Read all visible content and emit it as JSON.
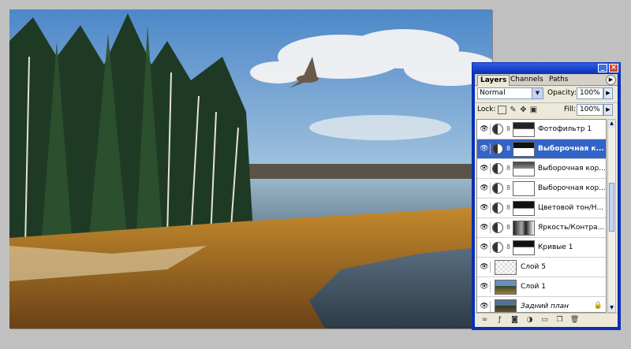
{
  "panel": {
    "tabs": [
      {
        "label": "Layers",
        "active": true
      },
      {
        "label": "Channels",
        "active": false
      },
      {
        "label": "Paths",
        "active": false
      }
    ],
    "blend_mode": "Normal",
    "opacity_label": "Opacity:",
    "opacity_value": "100%",
    "lock_label": "Lock:",
    "fill_label": "Fill:",
    "fill_value": "100%",
    "layers": [
      {
        "name": "Фотофильтр 1",
        "kind": "adjustment",
        "mask": "dark-top",
        "selected": false
      },
      {
        "name": "Выборочная к...",
        "kind": "adjustment",
        "mask": "dark-top",
        "selected": true
      },
      {
        "name": "Выборочная кор...",
        "kind": "adjustment",
        "mask": "grey-top",
        "selected": false
      },
      {
        "name": "Выборочная кор...",
        "kind": "adjustment",
        "mask": "white",
        "selected": false
      },
      {
        "name": "Цветовой тон/Н...",
        "kind": "adjustment",
        "mask": "dark-top",
        "selected": false
      },
      {
        "name": "Яркость/Контра...",
        "kind": "adjustment",
        "mask": "dark-mixed",
        "selected": false
      },
      {
        "name": "Кривые 1",
        "kind": "adjustment",
        "mask": "dark-top",
        "selected": false
      },
      {
        "name": "Слой 5",
        "kind": "transparent",
        "selected": false
      },
      {
        "name": "Слой 1",
        "kind": "photo",
        "selected": false
      },
      {
        "name": "Задний план",
        "kind": "photo",
        "selected": false,
        "locked": true
      }
    ]
  },
  "colors": {
    "titlebar": "#0a2fb4",
    "selected_row": "#3264c8",
    "panel_bg": "#ece9d8"
  }
}
